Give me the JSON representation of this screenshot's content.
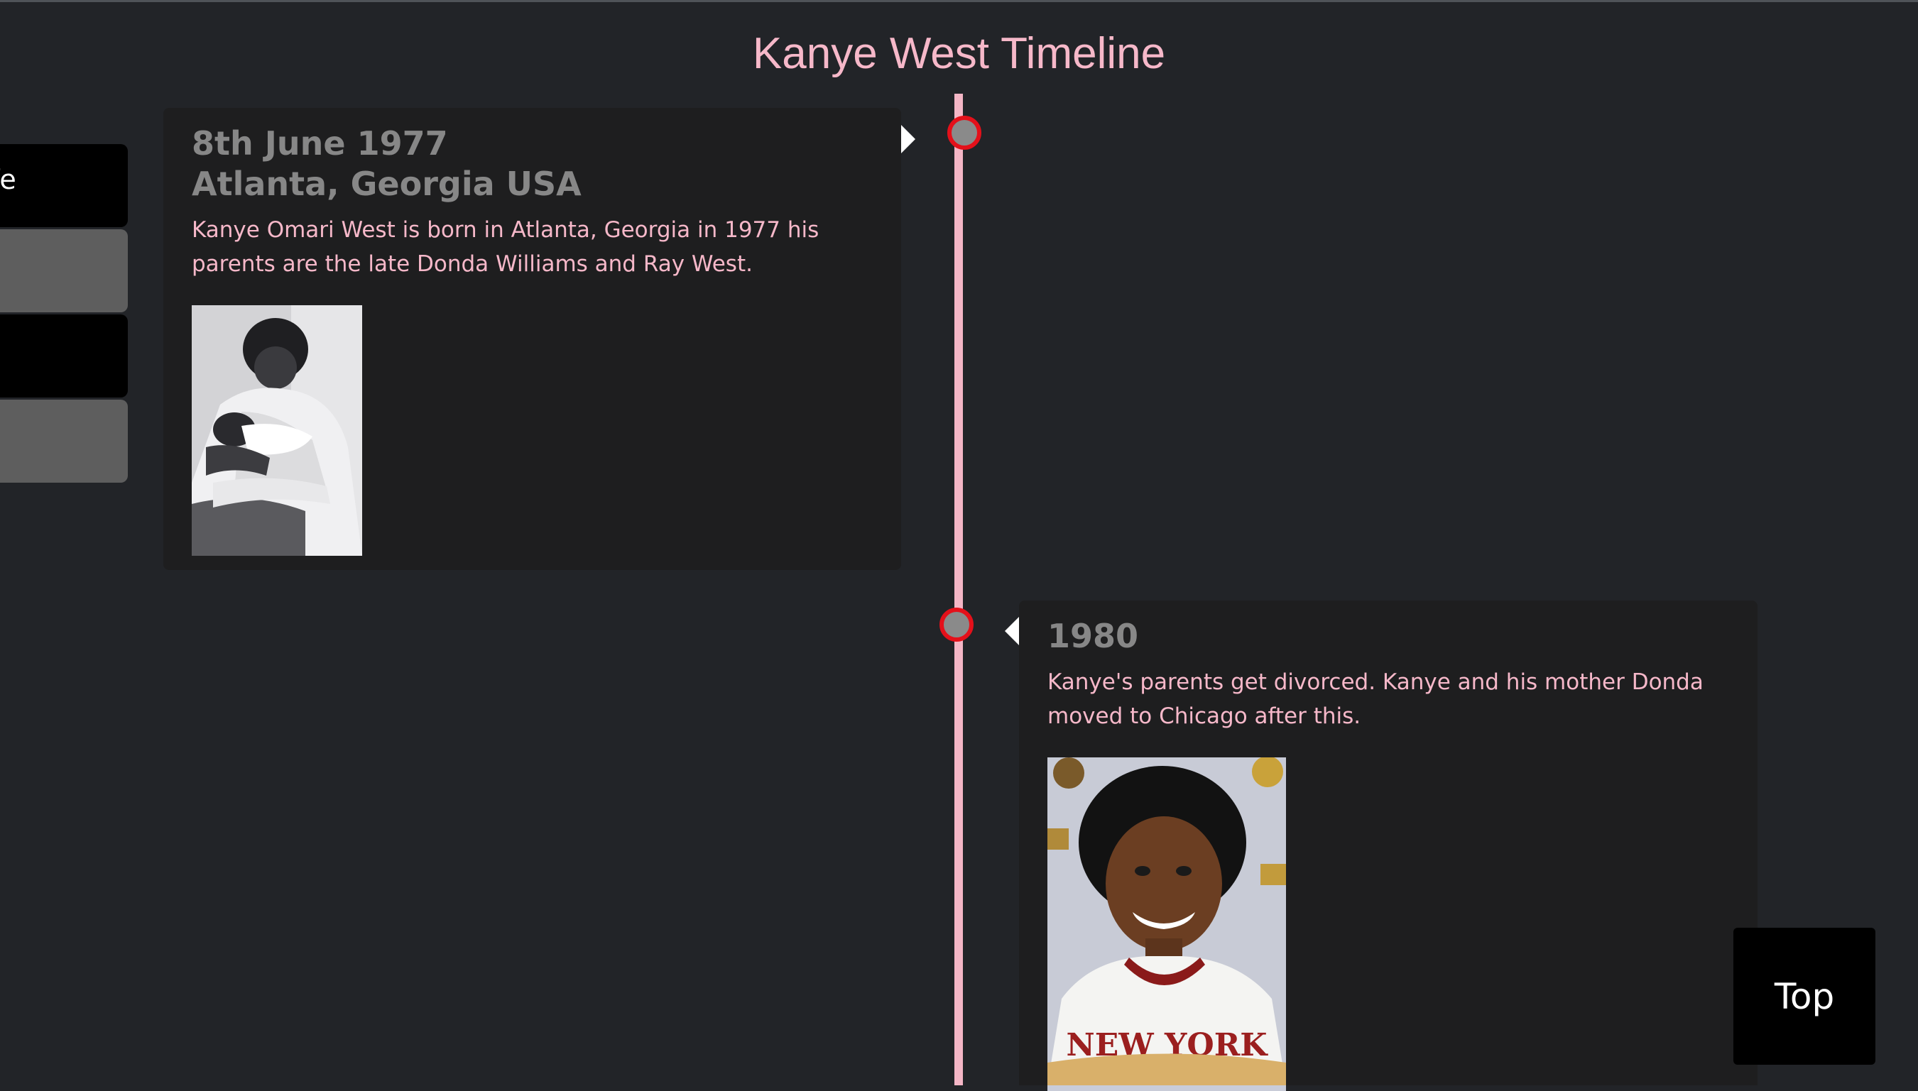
{
  "page": {
    "title": "Kanye West Timeline"
  },
  "side_nav": {
    "items": [
      {
        "label": "fe",
        "style": "dark"
      },
      {
        "label": "",
        "style": "gray"
      },
      {
        "label": "",
        "style": "dark"
      },
      {
        "label": "",
        "style": "gray"
      }
    ]
  },
  "timeline": {
    "events": [
      {
        "date_line1": "8th June 1977",
        "date_line2": "Atlanta, Georgia USA",
        "text": "Kanye Omari West is born in Atlanta, Georgia in 1977 his parents are the late Donda Williams and Ray West.",
        "side": "left"
      },
      {
        "date_line1": "1980",
        "text": "Kanye's parents get divorced. Kanye and his mother Donda moved to Chicago after this.",
        "shirt_text": "NEW YORK",
        "side": "right"
      }
    ]
  },
  "top_button": {
    "label": "Top"
  },
  "colors": {
    "background": "#222428",
    "accent_pink": "#f6b8c9",
    "dot_ring": "#e4101a",
    "card_bg": "#1e1e1f"
  }
}
